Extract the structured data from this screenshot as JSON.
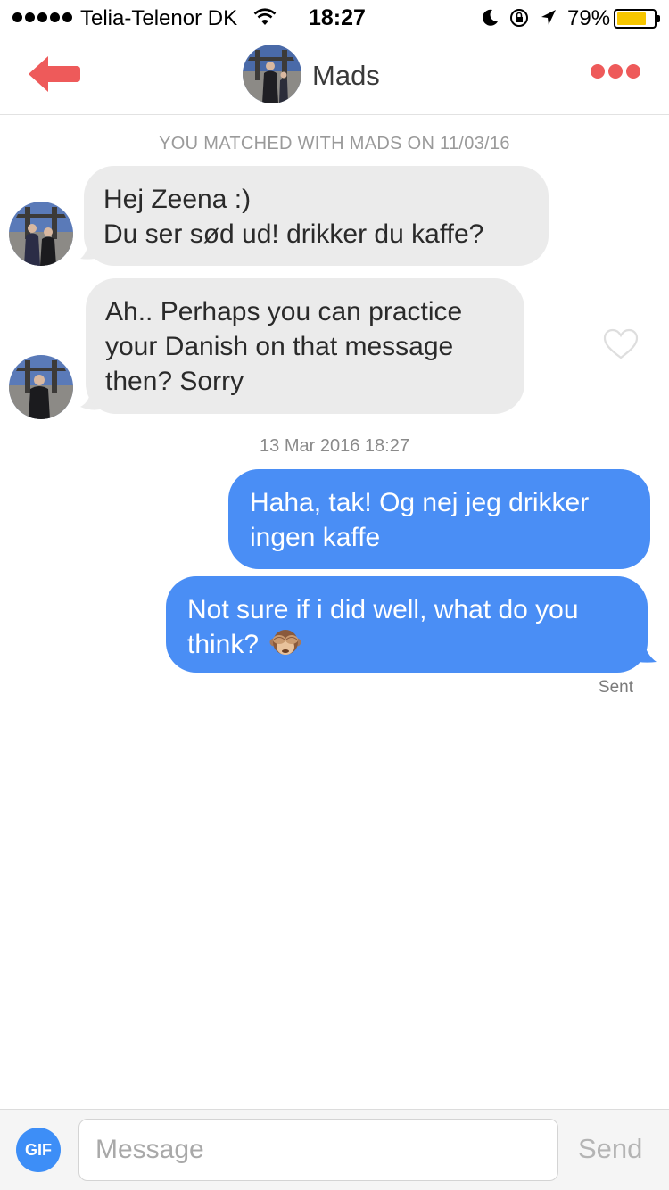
{
  "status_bar": {
    "carrier": "Telia-Telenor DK",
    "time": "18:27",
    "battery_percent": "79%",
    "battery_level": 0.79,
    "signal_bars": 5,
    "icons": [
      "wifi-icon",
      "do-not-disturb-moon-icon",
      "rotation-lock-icon",
      "location-arrow-icon",
      "battery-icon"
    ]
  },
  "header": {
    "name": "Mads",
    "back_icon": "back-arrow-icon",
    "more_icon": "more-dots-icon",
    "accent_color": "#ee5a5a"
  },
  "chat": {
    "match_notice": "YOU MATCHED WITH MADS ON 11/03/16",
    "incoming": [
      {
        "lines": [
          "Hej Zeena :)",
          "Du ser sød ud! drikker du kaffe?"
        ]
      },
      {
        "lines": [
          "Ah.. Perhaps you can practice",
          "your Danish on that message",
          "then? Sorry"
        ]
      }
    ],
    "timestamp": "13 Mar 2016 18:27",
    "outgoing": [
      {
        "lines": [
          "Haha, tak! Og nej jeg drikker",
          "ingen kaffe"
        ]
      },
      {
        "lines": [
          "Not sure if i did well, what do you",
          "think?"
        ],
        "emoji": "see-no-evil-monkey"
      }
    ],
    "sent_label": "Sent",
    "outgoing_color": "#4a8ef5",
    "incoming_color": "#ebebeb"
  },
  "composer": {
    "gif_label": "GIF",
    "placeholder": "Message",
    "send_label": "Send"
  }
}
